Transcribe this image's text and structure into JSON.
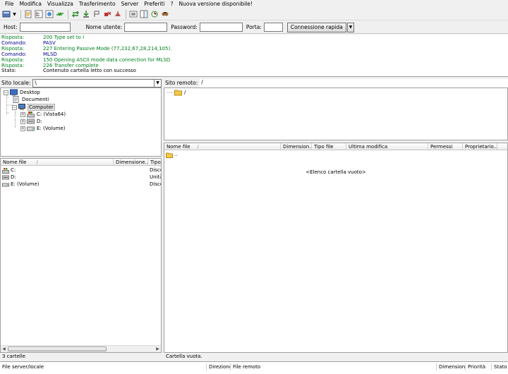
{
  "menu": [
    "File",
    "Modifica",
    "Visualizza",
    "Trasferimento",
    "Server",
    "Preferiti",
    "?",
    "Nuova versione disponibile!"
  ],
  "quickconnect": {
    "host_label": "Host:",
    "user_label": "Nome utente:",
    "password_label": "Password:",
    "port_label": "Porta:",
    "host_value": "",
    "user_value": "",
    "password_value": "",
    "port_value": "",
    "connect_label": "Connessione rapida",
    "dropdown_glyph": "▼"
  },
  "log": [
    {
      "label": "Risposta:",
      "message": "200 Type set to I",
      "kind": "resp"
    },
    {
      "label": "Comando:",
      "message": "PASV",
      "kind": "cmd"
    },
    {
      "label": "Risposta:",
      "message": "227 Entering Passive Mode (77,232,67,28,214,105).",
      "kind": "resp"
    },
    {
      "label": "Comando:",
      "message": "MLSD",
      "kind": "cmd"
    },
    {
      "label": "Risposta:",
      "message": "150 Opening ASCII mode data connection for MLSD",
      "kind": "resp"
    },
    {
      "label": "Risposta:",
      "message": "226 Transfer complete",
      "kind": "resp"
    },
    {
      "label": "Stato:",
      "message": "Contenuto cartella letto con successo",
      "kind": "stat"
    }
  ],
  "colors": {
    "response": "#00801c",
    "command": "#00008b",
    "status": "#000000"
  },
  "local": {
    "path_label": "Sito locale:",
    "path_value": "\\",
    "tree": [
      {
        "label": "Desktop",
        "icon": "desktop-icon",
        "expander": "−"
      },
      {
        "label": "Documenti",
        "icon": "documents-icon",
        "expander": ""
      },
      {
        "label": "Computer",
        "icon": "computer-icon",
        "expander": "−"
      },
      {
        "label": "C: (Vista64)",
        "icon": "system-drive-icon",
        "expander": "+"
      },
      {
        "label": "D:",
        "icon": "optical-drive-icon",
        "expander": "+"
      },
      {
        "label": "E: (Volume)",
        "icon": "hard-drive-icon",
        "expander": "+"
      }
    ],
    "columns": [
      "Nome file",
      "Dimensione...",
      "Tipo"
    ],
    "sort_glyph": "/",
    "files": [
      {
        "name": "C:",
        "size": "",
        "type": "Disco",
        "icon": "system-drive-icon"
      },
      {
        "name": "D:",
        "size": "",
        "type": "Unità",
        "icon": "optical-drive-icon"
      },
      {
        "name": "E: (Volume)",
        "size": "",
        "type": "Disco",
        "icon": "hard-drive-icon"
      }
    ],
    "status": "3 cartelle"
  },
  "remote": {
    "path_label": "Sito remoto:",
    "path_value": "/",
    "tree": [
      {
        "label": "/",
        "icon": "folder-icon"
      }
    ],
    "columns": [
      "Nome file",
      "Dimension...",
      "Tipo file",
      "Ultima modifica",
      "Permessi",
      "Proprietario..."
    ],
    "sort_glyph": "/",
    "files": [
      {
        "name": "..",
        "icon": "parent-folder-icon"
      }
    ],
    "empty_message": "<Elenco cartella vuoto>",
    "status": "Cartella vuota."
  },
  "queue": {
    "columns": [
      "File server/locale",
      "Direzione",
      "File remoto",
      "Dimensione",
      "Priorità",
      "Stato"
    ]
  }
}
